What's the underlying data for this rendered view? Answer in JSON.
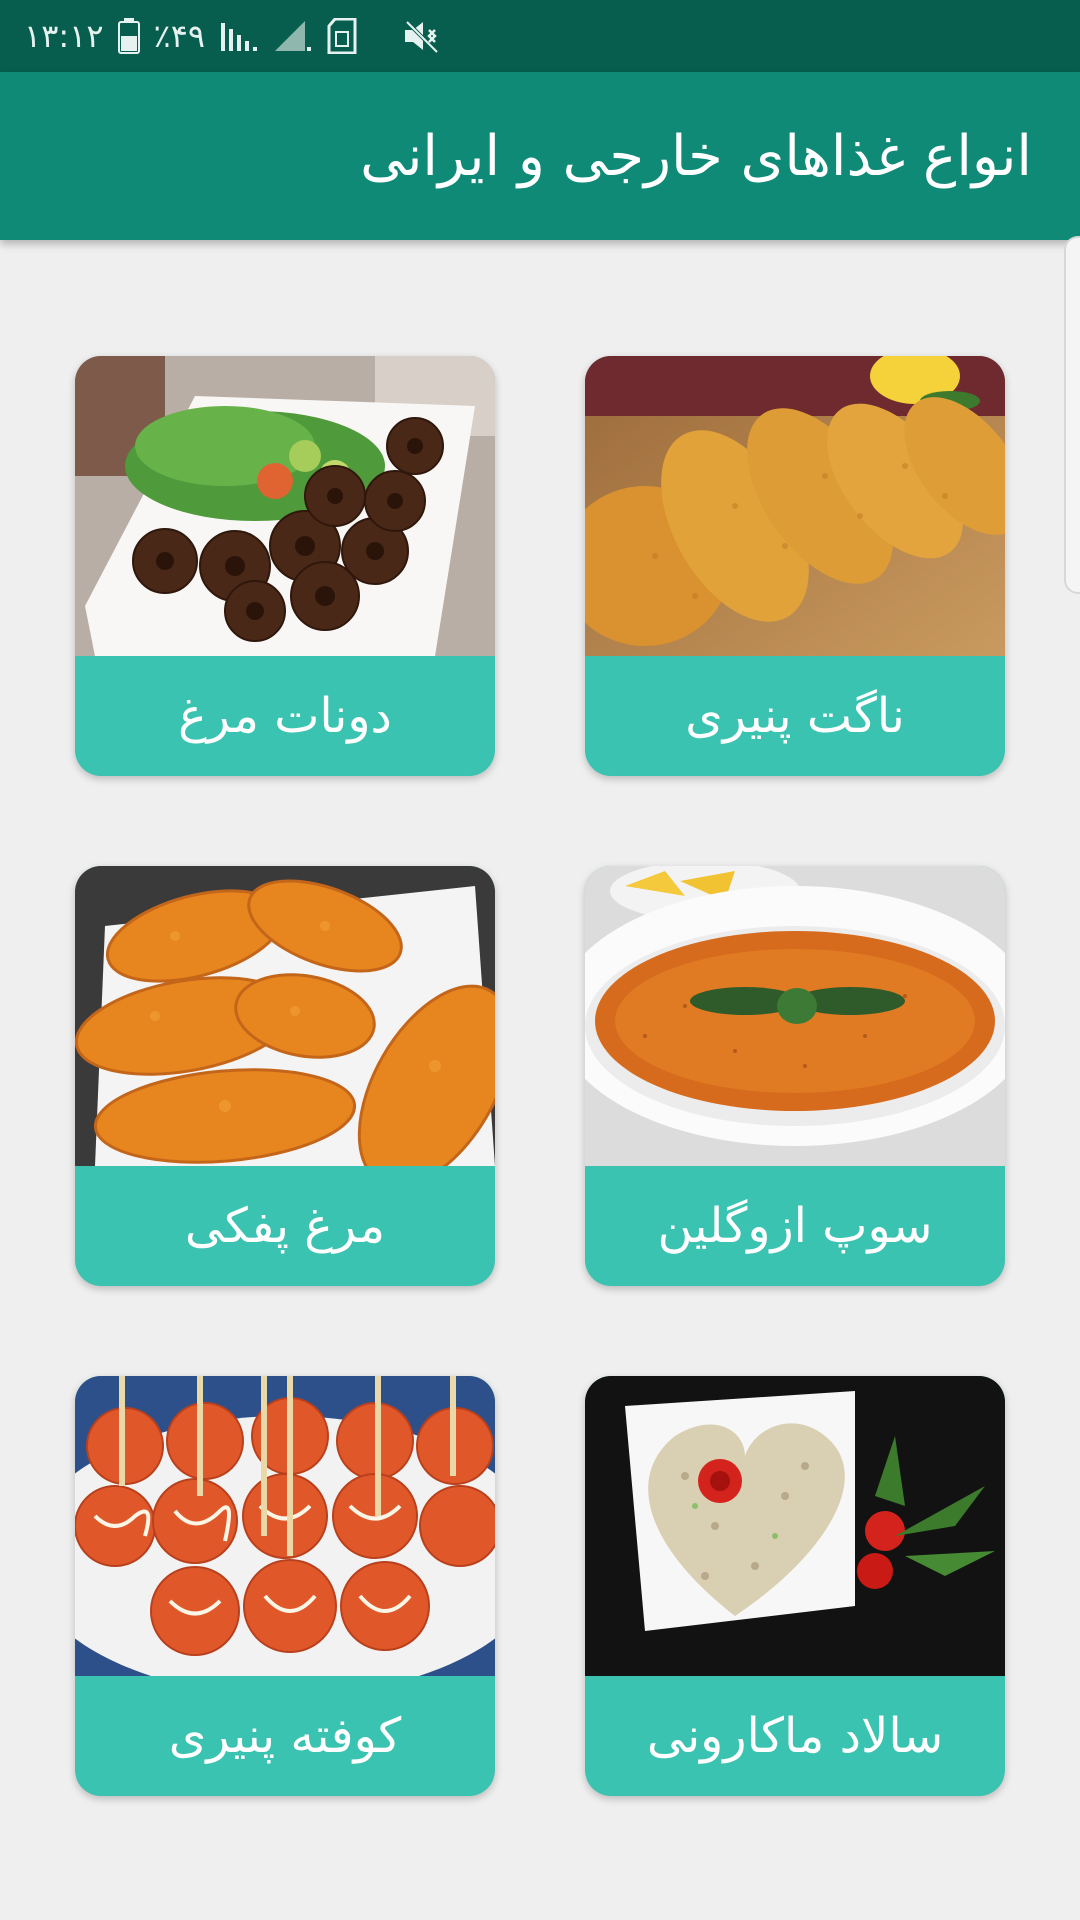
{
  "status_bar": {
    "time": "۱۳:۱۲",
    "battery": "٪۴۹",
    "icons": [
      "battery-icon",
      "signal-icon",
      "signal-weak-icon",
      "sim-card-icon",
      "mute-icon"
    ]
  },
  "app_bar": {
    "title": "انواع غذاهای خارجی و ایرانی"
  },
  "cards": [
    {
      "label": "ناگت پنیری",
      "image": "cheese-nugget-image"
    },
    {
      "label": "دونات مرغ",
      "image": "chicken-donut-image"
    },
    {
      "label": "سوپ ازوگلین",
      "image": "ezogelin-soup-image"
    },
    {
      "label": "مرغ پفکی",
      "image": "crispy-chicken-image"
    },
    {
      "label": "سالاد ماکارونی",
      "image": "macaroni-salad-image"
    },
    {
      "label": "کوفته پنیری",
      "image": "cheese-meatball-image"
    }
  ],
  "colors": {
    "status_bar": "#075e4e",
    "app_bar": "#0f8a77",
    "card_label_bg": "#3ac3b0",
    "background": "#efefef"
  }
}
